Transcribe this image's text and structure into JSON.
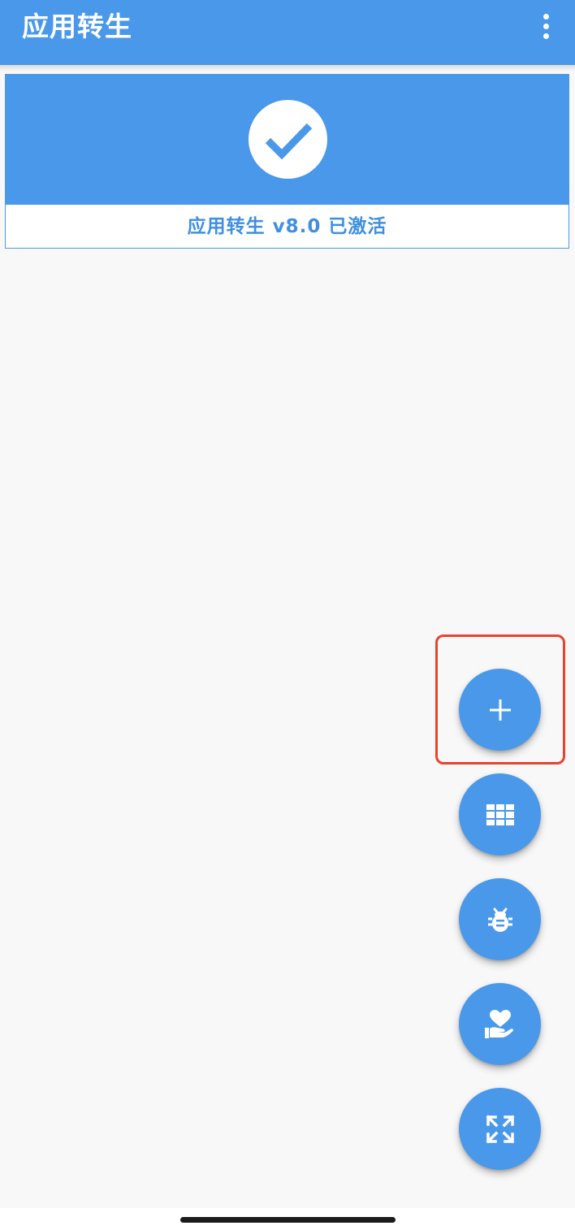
{
  "app": {
    "title": "应用转生"
  },
  "header": {
    "menu_icon": "more-vert-icon"
  },
  "status_card": {
    "icon": "check-circle-icon",
    "text": "应用转生 v8.0 已激活",
    "state": "activated"
  },
  "fabs": [
    {
      "name": "add",
      "icon": "plus-icon",
      "highlighted": true
    },
    {
      "name": "apps",
      "icon": "grid-icon"
    },
    {
      "name": "debug",
      "icon": "bug-icon"
    },
    {
      "name": "donate",
      "icon": "heart-hand-icon"
    },
    {
      "name": "expand",
      "icon": "expand-arrows-icon"
    }
  ],
  "colors": {
    "primary": "#4a98ea",
    "status_text": "#3f8fe0",
    "background": "#f8f8f8",
    "highlight": "#e8432e"
  }
}
